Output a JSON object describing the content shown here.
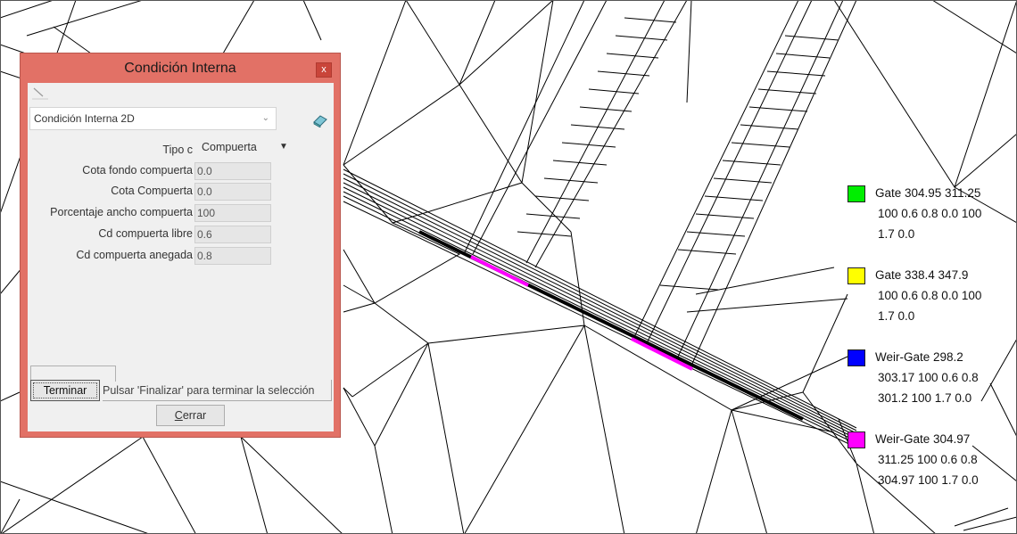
{
  "dialog": {
    "title": "Condición Interna",
    "close_glyph": "x",
    "combo_value": "Condición Interna 2D",
    "combo_arrow": "⌄",
    "tipo_label": "Tipo c",
    "tipo_value": "Compuerta",
    "tipo_arrow": "▼",
    "fields": [
      {
        "label": "Cota fondo compuerta",
        "value": "0.0"
      },
      {
        "label": "Cota Compuerta",
        "value": "0.0"
      },
      {
        "label": "Porcentaje ancho compuerta",
        "value": "100"
      },
      {
        "label": "Cd compuerta libre",
        "value": "0.6"
      },
      {
        "label": "Cd compuerta anegada",
        "value": "0.8"
      }
    ],
    "terminar_label": "Terminar",
    "status_text": "Pulsar 'Finalizar' para terminar la selección",
    "cerrar_label": "Cerrar"
  },
  "legend": [
    {
      "color": "#00ee00",
      "lines": [
        "Gate 304.95 311.25",
        "100 0.6 0.8 0.0 100",
        "1.7 0.0"
      ]
    },
    {
      "color": "#ffff00",
      "lines": [
        "Gate 338.4 347.9",
        "100 0.6 0.8 0.0 100",
        "1.7 0.0"
      ]
    },
    {
      "color": "#0000ff",
      "lines": [
        "Weir-Gate 298.2",
        "303.17 100 0.6 0.8",
        "301.2 100 1.7 0.0"
      ]
    },
    {
      "color": "#ff00ff",
      "lines": [
        "Weir-Gate 304.97",
        "311.25 100 0.6 0.8",
        "304.97 100 1.7 0.0"
      ]
    }
  ],
  "mesh_highlight_color": "#ff00ff",
  "icons": [
    "close-icon",
    "pencil-icon",
    "eraser-icon",
    "dropdown-arrow-icon"
  ]
}
